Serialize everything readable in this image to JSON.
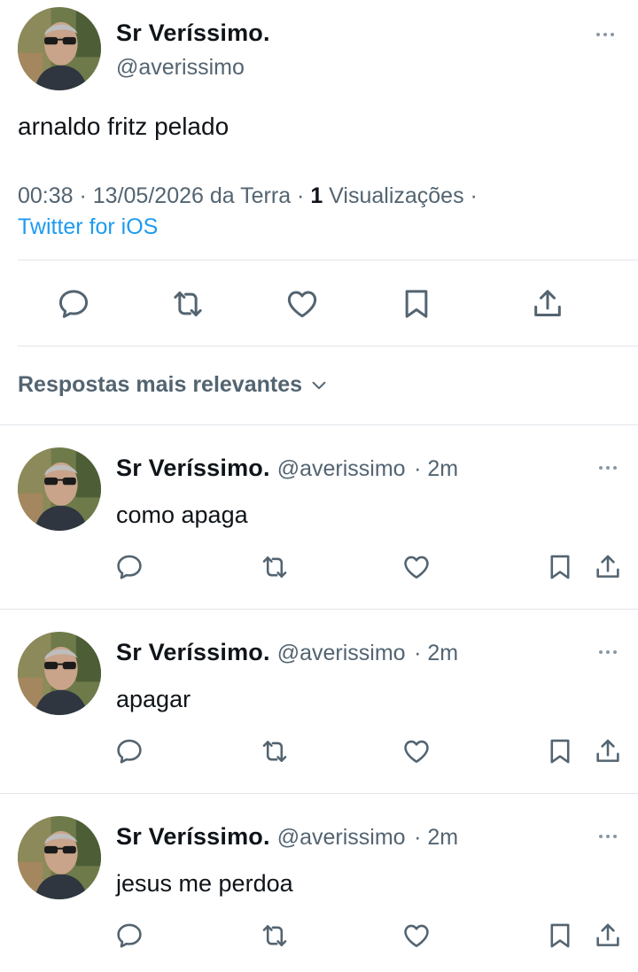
{
  "author": {
    "name": "Sr Veríssimo.",
    "handle": "@averissimo"
  },
  "tweet": {
    "text": "arnaldo fritz pelado",
    "time": "00:38 · 13/05/2026 da Terra · ",
    "views_count": "1",
    "views_label": " Visualizações ·",
    "source": "Twitter for iOS"
  },
  "sort": {
    "label": "Respostas mais relevantes"
  },
  "replies": [
    {
      "name": "Sr Veríssimo.",
      "handle": "@averissimo",
      "age": "· 2m",
      "text": "como apaga"
    },
    {
      "name": "Sr Veríssimo.",
      "handle": "@averissimo",
      "age": "· 2m",
      "text": "apagar"
    },
    {
      "name": "Sr Veríssimo.",
      "handle": "@averissimo",
      "age": "· 2m",
      "text": "jesus me perdoa"
    }
  ],
  "icons": {
    "reply": "reply-icon",
    "retweet": "retweet-icon",
    "like": "heart-icon",
    "bookmark": "bookmark-icon",
    "share": "share-icon",
    "more": "more-dots-icon",
    "sort": "chevron-down-icon"
  },
  "colors": {
    "text": "#0f1419",
    "secondary": "#536471",
    "link": "#1d9bf0",
    "divider": "#e1e6ea"
  }
}
